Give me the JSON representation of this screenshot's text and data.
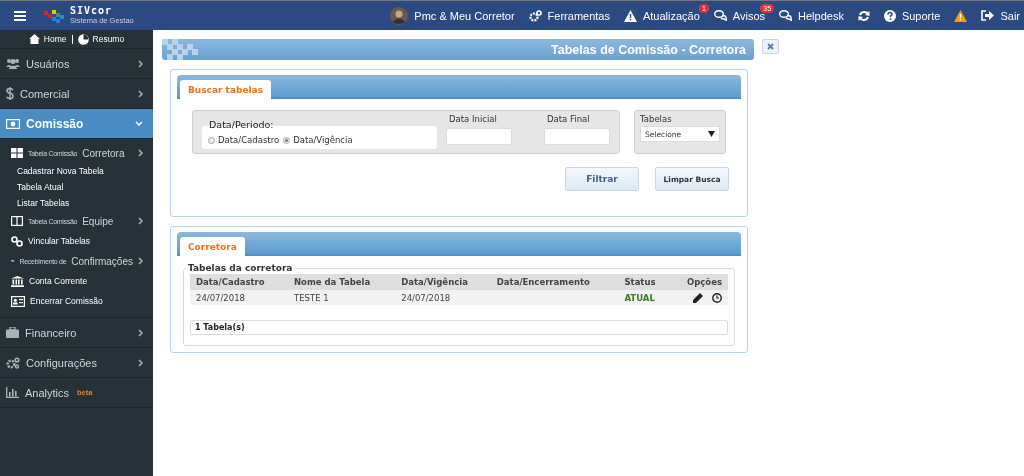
{
  "topbar": {
    "logo_title": "SIVcor",
    "logo_subtitle": "Sistema de Gestao",
    "user": "Pmc & Meu Corretor",
    "items": [
      {
        "kind": "link",
        "label": "Ferramentas"
      },
      {
        "kind": "link",
        "label": "Atualização",
        "badge": "1"
      },
      {
        "kind": "link",
        "label": "Avisos",
        "badge": "35"
      },
      {
        "kind": "link",
        "label": "Helpdesk"
      },
      {
        "kind": "icon"
      },
      {
        "kind": "link",
        "label": "Suporte"
      },
      {
        "kind": "icon"
      },
      {
        "kind": "link",
        "label": "Sair"
      }
    ]
  },
  "sidebar": {
    "home": "Home",
    "resumo": "Resumo",
    "items": [
      {
        "label": "Usuários",
        "selected": false,
        "expanded": false
      },
      {
        "label": "Comercial",
        "selected": false,
        "expanded": false
      },
      {
        "label": "Comissão",
        "selected": true,
        "expanded": true,
        "children": [
          {
            "kind": "group",
            "prefix": "Tabela Comissão",
            "label": "Corretora",
            "children": [
              {
                "label": "Cadastrar Nova Tabela"
              },
              {
                "label": "Tabela Atual"
              },
              {
                "label": "Listar Tabelas"
              }
            ]
          },
          {
            "kind": "group",
            "prefix": "Tabela Comissão",
            "label": "Equipe"
          },
          {
            "kind": "link",
            "label": "Vincular Tabelas"
          },
          {
            "kind": "group",
            "prefix": "Recebimento de",
            "label": "Confirmações"
          },
          {
            "kind": "link",
            "label": "Conta Corrente"
          },
          {
            "kind": "link",
            "label": "Encerrar Comissão"
          }
        ]
      },
      {
        "label": "Financeiro",
        "selected": false,
        "expanded": false
      },
      {
        "label": "Configurações",
        "selected": false,
        "expanded": false
      },
      {
        "label": "Analytics",
        "badge": "beta",
        "selected": false
      }
    ]
  },
  "page": {
    "title": "Tabelas de Comissão - Corretora",
    "search": {
      "tab": "Buscar tabelas",
      "period_label": "Data/Periodo:",
      "radios": [
        {
          "label": "Data/Cadastro",
          "selected": false
        },
        {
          "label": "Data/Vigência",
          "selected": true
        }
      ],
      "start_label": "Data Inicial",
      "end_label": "Data Final",
      "tables_label": "Tabelas",
      "tables_value": "Selecione",
      "buttons": [
        "Filtrar",
        "Limpar Busca"
      ]
    },
    "results": {
      "tab": "Corretora",
      "legend": "Tabelas da corretora",
      "columns": [
        "Data/Cadastro",
        "Nome da Tabela",
        "Data/Vigência",
        "Data/Encerramento",
        "Status",
        "Opções"
      ],
      "rows": [
        {
          "cells": [
            "24/07/2018",
            "TESTE 1",
            "24/07/2018",
            "",
            "ATUAL"
          ]
        }
      ],
      "footer": "1 Tabela(s)"
    }
  }
}
